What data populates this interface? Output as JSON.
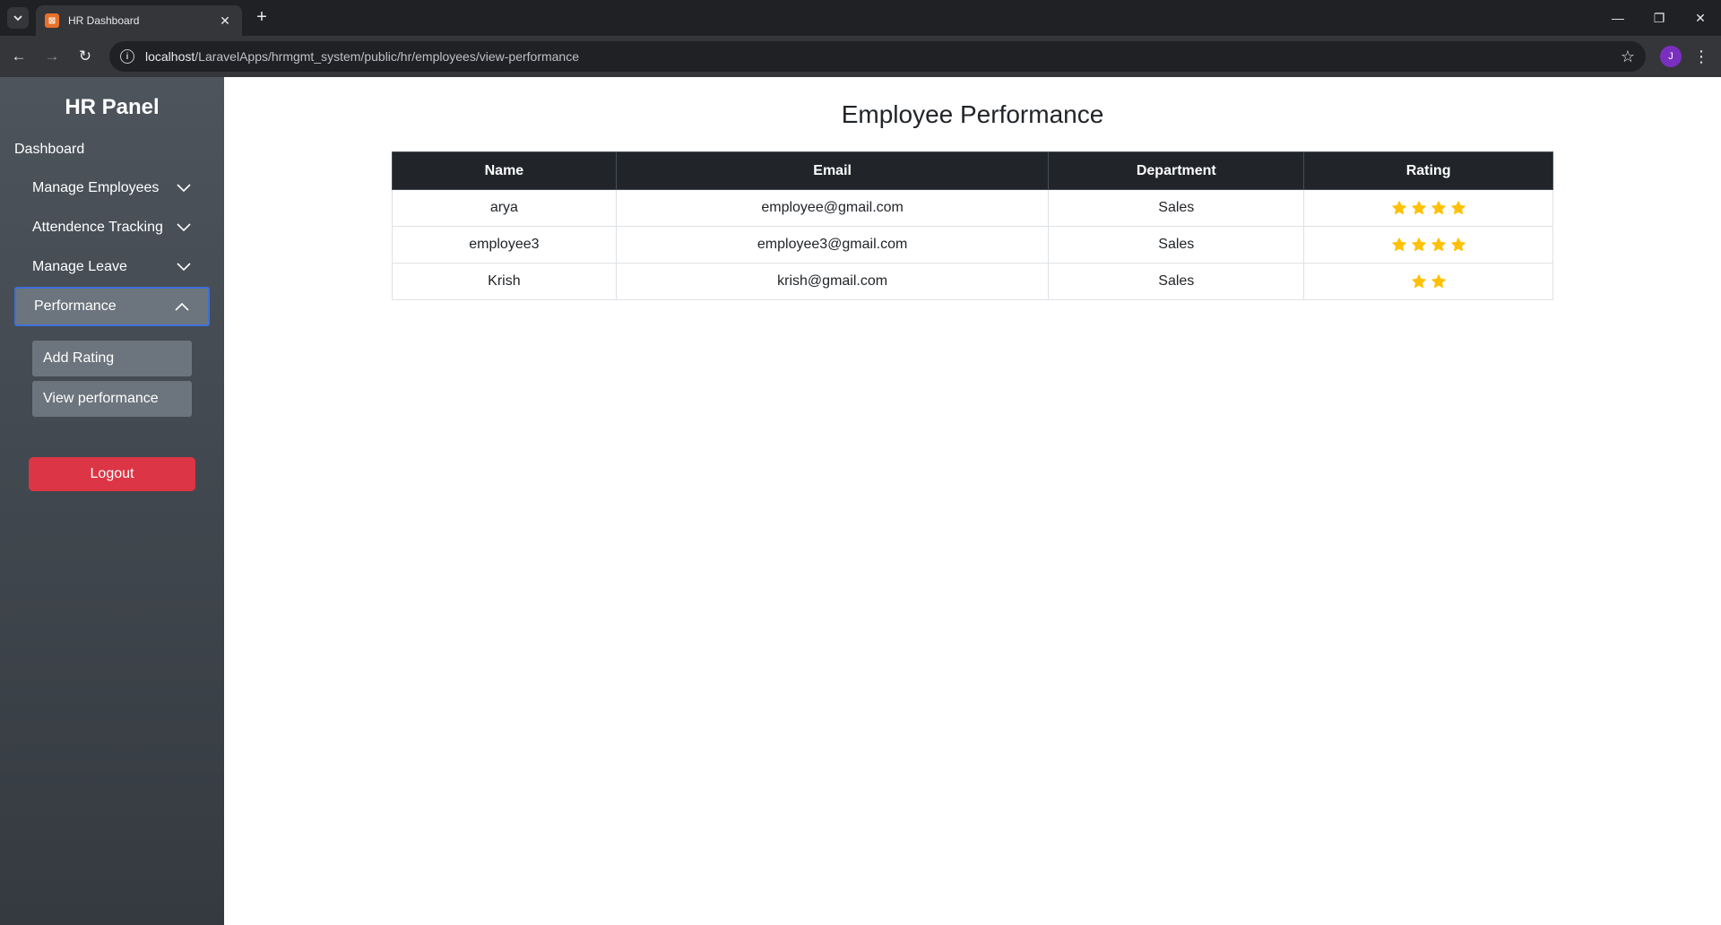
{
  "browser": {
    "tab_title": "HR Dashboard",
    "url_host": "localhost",
    "url_path": "/LaravelApps/hrmgmt_system/public/hr/employees/view-performance",
    "profile_initial": "J"
  },
  "sidebar": {
    "brand": "HR Panel",
    "dashboard_label": "Dashboard",
    "menu": [
      {
        "label": "Manage Employees",
        "expanded": false
      },
      {
        "label": "Attendence Tracking",
        "expanded": false
      },
      {
        "label": "Manage Leave",
        "expanded": false
      },
      {
        "label": "Performance",
        "expanded": true
      }
    ],
    "submenu": [
      {
        "label": "Add Rating"
      },
      {
        "label": "View performance"
      }
    ],
    "logout_label": "Logout"
  },
  "main": {
    "title": "Employee Performance",
    "columns": [
      "Name",
      "Email",
      "Department",
      "Rating"
    ],
    "rows": [
      {
        "name": "arya",
        "email": "employee@gmail.com",
        "department": "Sales",
        "rating": 4
      },
      {
        "name": "employee3",
        "email": "employee3@gmail.com",
        "department": "Sales",
        "rating": 4
      },
      {
        "name": "Krish",
        "email": "krish@gmail.com",
        "department": "Sales",
        "rating": 2
      }
    ],
    "star_color": "#ffc107"
  },
  "colors": {
    "sidebar": "#4d545c",
    "active_border": "#3d6fd9",
    "logout": "#dc3545",
    "table_header": "#212529"
  }
}
